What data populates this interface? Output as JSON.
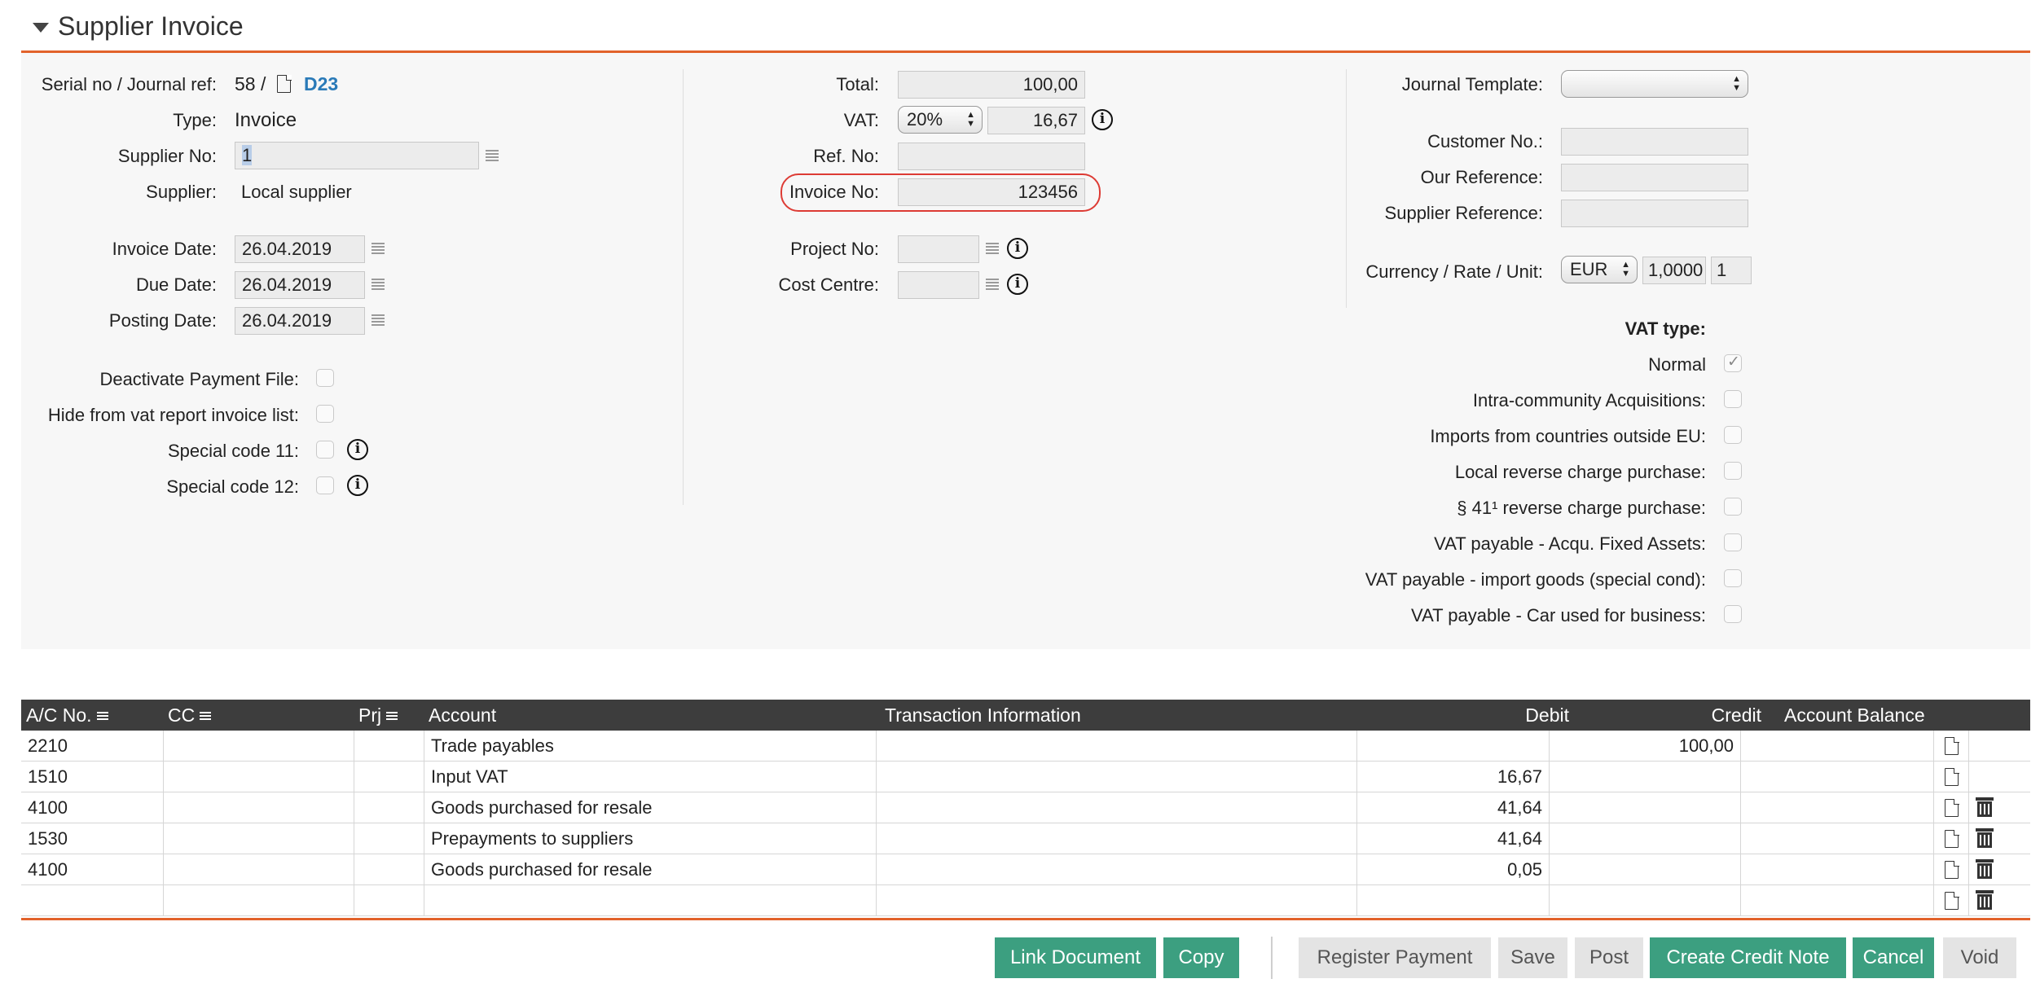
{
  "header": {
    "title": "Supplier Invoice"
  },
  "left": {
    "serial_label": "Serial no / Journal ref:",
    "serial_value": "58 /",
    "journal_ref": "D23",
    "type_label": "Type:",
    "type_value": "Invoice",
    "supplier_no_label": "Supplier No:",
    "supplier_no_value": "1",
    "supplier_label": "Supplier:",
    "supplier_value": "Local supplier",
    "invoice_date_label": "Invoice Date:",
    "invoice_date_value": "26.04.2019",
    "due_date_label": "Due Date:",
    "due_date_value": "26.04.2019",
    "posting_date_label": "Posting Date:",
    "posting_date_value": "26.04.2019",
    "deactivate_label": "Deactivate Payment File:",
    "hide_vat_label": "Hide from vat report invoice list:",
    "special11_label": "Special code 11:",
    "special12_label": "Special code 12:"
  },
  "middle": {
    "total_label": "Total:",
    "total_value": "100,00",
    "vat_label": "VAT:",
    "vat_rate": "20%",
    "vat_value": "16,67",
    "ref_label": "Ref. No:",
    "ref_value": "",
    "invoice_no_label": "Invoice No:",
    "invoice_no_value": "123456",
    "project_label": "Project No:",
    "project_value": "",
    "cost_centre_label": "Cost Centre:",
    "cost_centre_value": ""
  },
  "right": {
    "journal_template_label": "Journal Template:",
    "journal_template_value": "",
    "customer_no_label": "Customer No.:",
    "our_reference_label": "Our Reference:",
    "supplier_reference_label": "Supplier Reference:",
    "currency_label": "Currency / Rate / Unit:",
    "currency_value": "EUR",
    "rate_value": "1,0000",
    "unit_value": "1",
    "vat_type_heading": "VAT type:",
    "vat_types": [
      {
        "label": "Normal",
        "checked": true
      },
      {
        "label": "Intra-community Acquisitions:",
        "checked": false
      },
      {
        "label": "Imports from countries outside EU:",
        "checked": false
      },
      {
        "label": "Local reverse charge purchase:",
        "checked": false
      },
      {
        "label": "§ 41¹ reverse charge purchase:",
        "checked": false
      },
      {
        "label": "VAT payable - Acqu. Fixed Assets:",
        "checked": false
      },
      {
        "label": "VAT payable - import goods (special cond):",
        "checked": false
      },
      {
        "label": "VAT payable - Car used for business:",
        "checked": false
      }
    ]
  },
  "table": {
    "columns": {
      "ac": "A/C No.",
      "cc": "CC",
      "prj": "Prj",
      "account": "Account",
      "transaction": "Transaction Information",
      "debit": "Debit",
      "credit": "Credit",
      "balance": "Account Balance"
    },
    "rows": [
      {
        "ac": "2210",
        "cc": "",
        "prj": "",
        "account": "Trade payables",
        "transaction": "",
        "debit": "",
        "credit": "100,00",
        "balance": "",
        "deletable": false
      },
      {
        "ac": "1510",
        "cc": "",
        "prj": "",
        "account": "Input VAT",
        "transaction": "",
        "debit": "16,67",
        "credit": "",
        "balance": "",
        "deletable": false
      },
      {
        "ac": "4100",
        "cc": "",
        "prj": "",
        "account": "Goods purchased for resale",
        "transaction": "",
        "debit": "41,64",
        "credit": "",
        "balance": "",
        "deletable": true
      },
      {
        "ac": "1530",
        "cc": "",
        "prj": "",
        "account": "Prepayments to suppliers",
        "transaction": "",
        "debit": "41,64",
        "credit": "",
        "balance": "",
        "deletable": true
      },
      {
        "ac": "4100",
        "cc": "",
        "prj": "",
        "account": "Goods purchased for resale",
        "transaction": "",
        "debit": "0,05",
        "credit": "",
        "balance": "",
        "deletable": true
      },
      {
        "ac": "",
        "cc": "",
        "prj": "",
        "account": "",
        "transaction": "",
        "debit": "",
        "credit": "",
        "balance": "",
        "deletable": true
      }
    ]
  },
  "buttons": {
    "link_document": "Link Document",
    "copy": "Copy",
    "register_payment": "Register Payment",
    "save": "Save",
    "post": "Post",
    "create_credit_note": "Create Credit Note",
    "cancel": "Cancel",
    "void": "Void"
  },
  "colors": {
    "accent": "#e2622b",
    "button_green": "#3c9f80",
    "link_blue": "#2a7ab8",
    "highlight_red": "#dd3b34"
  }
}
